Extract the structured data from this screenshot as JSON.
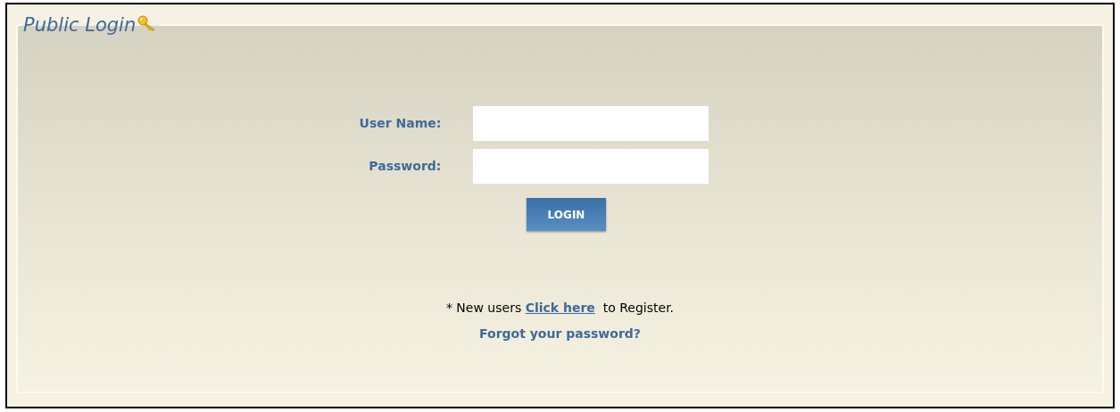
{
  "panel": {
    "title": "Public Login"
  },
  "fields": [
    {
      "label": "User Name:"
    },
    {
      "label": "Password:"
    }
  ],
  "login_button": {
    "label": "LOGIN"
  },
  "register_note": {
    "before": "* New users ",
    "link": "Click here",
    "after": "  to Register."
  },
  "forgot_link": {
    "label": "Forgot your password?"
  }
}
